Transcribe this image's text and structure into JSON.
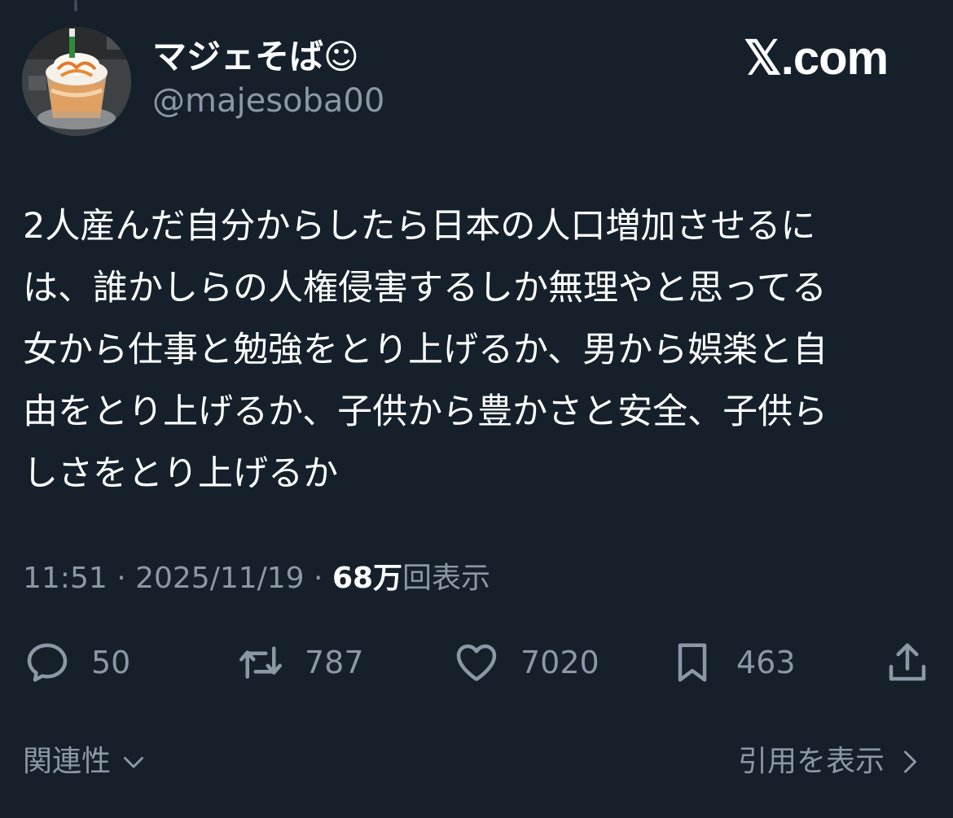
{
  "author": {
    "display_name": "マジェそば☺",
    "handle": "@majesoba00"
  },
  "brand": {
    "text": "𝕏.com"
  },
  "tweet": {
    "lines": [
      "2人産んだ自分からしたら日本の人口増加させるに",
      "は、誰かしらの人権侵害するしか無理やと思ってる",
      "女から仕事と勉強をとり上げるか、男から娯楽と自",
      "由をとり上げるか、子供から豊かさと安全、子供ら",
      "しさをとり上げるか"
    ]
  },
  "meta": {
    "time": "11:51",
    "separator": " · ",
    "date": "2025/11/19",
    "views_count": "68万",
    "views_label": "回表示"
  },
  "actions": {
    "replies": "50",
    "retweets": "787",
    "likes": "7020",
    "bookmarks": "463"
  },
  "footer": {
    "related_label": "関連性",
    "quotes_label": "引用を表示"
  },
  "colors": {
    "background": "#15202b",
    "text_primary": "#ffffff",
    "text_secondary": "#8b98a5"
  },
  "icons": {
    "reply": "speech-bubble-icon",
    "retweet": "retweet-arrows-icon",
    "like": "heart-icon",
    "bookmark": "bookmark-icon",
    "share": "share-upload-icon",
    "related": "chevron-down-icon",
    "quotes": "chevron-right-icon"
  }
}
